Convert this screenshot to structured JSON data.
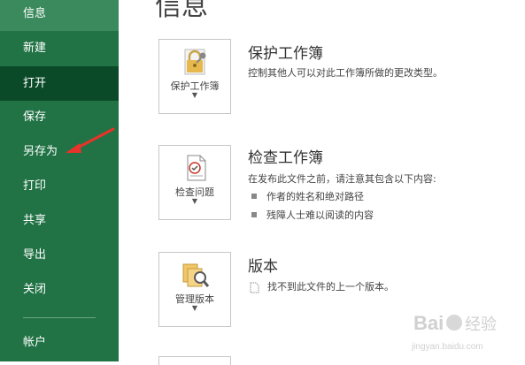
{
  "sidebar": {
    "items": [
      {
        "label": "信息"
      },
      {
        "label": "新建"
      },
      {
        "label": "打开"
      },
      {
        "label": "保存"
      },
      {
        "label": "另存为"
      },
      {
        "label": "打印"
      },
      {
        "label": "共享"
      },
      {
        "label": "导出"
      },
      {
        "label": "关闭"
      }
    ],
    "account_label": "帐户",
    "accent_color": "#217346"
  },
  "main": {
    "title": "信息",
    "protect": {
      "button_label": "保护工作簿",
      "title": "保护工作簿",
      "description": "控制其他人可以对此工作簿所做的更改类型。",
      "icon": "lock-key-icon"
    },
    "inspect": {
      "button_label": "检查问题",
      "title": "检查工作簿",
      "description": "在发布此文件之前，请注意其包含以下内容:",
      "bullets": [
        "作者的姓名和绝对路径",
        "残障人士难以阅读的内容"
      ],
      "icon": "inspect-document-icon"
    },
    "versions": {
      "button_label": "管理版本",
      "title": "版本",
      "description": "找不到此文件的上一个版本。",
      "icon": "manage-versions-icon"
    }
  },
  "watermark": {
    "brand": "Baidu",
    "sub_cn": "经验",
    "url": "jingyan.baidu.com"
  }
}
